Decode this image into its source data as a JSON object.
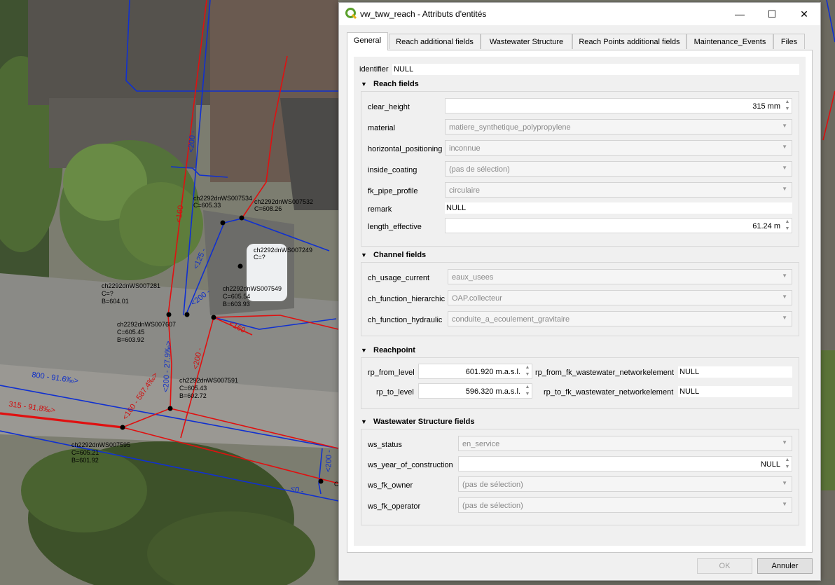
{
  "dialog": {
    "title": "vw_tww_reach - Attributs d'entités",
    "window_buttons": {
      "minimize": "—",
      "maximize": "☐",
      "close": "✕"
    },
    "tabs": [
      "General",
      "Reach additional fields",
      "Wastewater Structure",
      "Reach Points additional fields",
      "Maintenance_Events",
      "Files"
    ],
    "active_tab": "General",
    "identifier": {
      "label": "identifier",
      "value": "NULL"
    },
    "reach_fields": {
      "title": "Reach fields",
      "clear_height": {
        "label": "clear_height",
        "value": "315 mm"
      },
      "material": {
        "label": "material",
        "value": "matiere_synthetique_polypropylene"
      },
      "horizontal_positioning": {
        "label": "horizontal_positioning",
        "value": "inconnue"
      },
      "inside_coating": {
        "label": "inside_coating",
        "value": "(pas de sélection)"
      },
      "fk_pipe_profile": {
        "label": "fk_pipe_profile",
        "value": "circulaire"
      },
      "remark": {
        "label": "remark",
        "value": "NULL"
      },
      "length_effective": {
        "label": "length_effective",
        "value": "61.24 m"
      }
    },
    "channel_fields": {
      "title": "Channel fields",
      "ch_usage_current": {
        "label": "ch_usage_current",
        "value": "eaux_usees"
      },
      "ch_function_hierarchic": {
        "label": "ch_function_hierarchic",
        "value": "OAP.collecteur"
      },
      "ch_function_hydraulic": {
        "label": "ch_function_hydraulic",
        "value": "conduite_a_ecoulement_gravitaire"
      }
    },
    "reachpoint": {
      "title": "Reachpoint",
      "rp_from_level": {
        "label": "rp_from_level",
        "value": "601.920 m.a.s.l."
      },
      "rp_from_fk": {
        "label": "rp_from_fk_wastewater_networkelement",
        "value": "NULL"
      },
      "rp_to_level": {
        "label": "rp_to_level",
        "value": "596.320 m.a.s.l."
      },
      "rp_to_fk": {
        "label": "rp_to_fk_wastewater_networkelement",
        "value": "NULL"
      }
    },
    "ws_fields": {
      "title": "Wastewater Structure fields",
      "ws_status": {
        "label": "ws_status",
        "value": "en_service"
      },
      "ws_year_of_construction": {
        "label": "ws_year_of_construction",
        "value": "NULL"
      },
      "ws_fk_owner": {
        "label": "ws_fk_owner",
        "value": "(pas de sélection)"
      },
      "ws_fk_operator": {
        "label": "ws_fk_operator",
        "value": "(pas de sélection)"
      }
    },
    "buttons": {
      "ok": "OK",
      "cancel": "Annuler"
    }
  },
  "map": {
    "labels": [
      {
        "lines": [
          "ch2292dnWS007534",
          "C=605.33"
        ]
      },
      {
        "lines": [
          "ch2292dnWS007532",
          "C=608.26"
        ]
      },
      {
        "lines": [
          "ch2292dnWS007249",
          "C=?"
        ]
      },
      {
        "lines": [
          "ch2292dnWS007281",
          "C=?",
          "B=604.01"
        ]
      },
      {
        "lines": [
          "ch2292dnWS007549",
          "C=605.54",
          "B=603.93"
        ]
      },
      {
        "lines": [
          "ch2292dnWS007607",
          "C=605.45",
          "B=603.92"
        ]
      },
      {
        "lines": [
          "ch2292dnWS007591",
          "C=605.43",
          "B=602.72"
        ]
      },
      {
        "lines": [
          "ch2292dnWS007595",
          "C=605.21",
          "B=601.92"
        ]
      }
    ],
    "pipe_labels": [
      "<200 -",
      "<160 -",
      "<125 -",
      "<200 -",
      "<160 -",
      "<200 -",
      "<200 - 27.9‰>",
      "<160 - 587.4‰>",
      "800 - 91.6‰>",
      "315 - 91.8‰>",
      "<200 -",
      "<0 -",
      "C"
    ],
    "colors": {
      "pipe_red": "#e01010",
      "pipe_blue": "#1030d0",
      "accent": "#1a8a2a"
    }
  }
}
